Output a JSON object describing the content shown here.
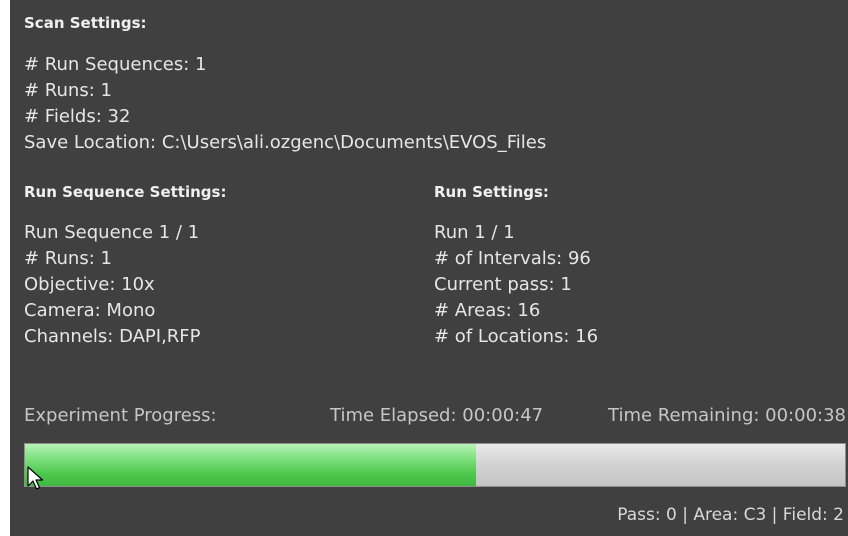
{
  "scan_settings": {
    "heading": "Scan Settings:",
    "lines": [
      "# Run Sequences: 1",
      "# Runs: 1",
      "# Fields: 32",
      "Save Location: C:\\Users\\ali.ozgenc\\Documents\\EVOS_Files"
    ]
  },
  "run_sequence_settings": {
    "heading": "Run Sequence Settings:",
    "lines": [
      "Run Sequence 1 / 1",
      "# Runs: 1",
      "Objective: 10x",
      "Camera: Mono",
      "Channels: DAPI,RFP"
    ]
  },
  "run_settings": {
    "heading": "Run Settings:",
    "lines": [
      "Run 1 / 1",
      "# of Intervals: 96",
      "Current pass: 1",
      "# Areas: 16",
      "# of Locations: 16"
    ]
  },
  "progress": {
    "label": "Experiment Progress:",
    "time_elapsed": "Time Elapsed: 00:00:47",
    "time_remaining": "Time Remaining: 00:00:38",
    "fraction": 0.55,
    "fill_color": "#4fc84f",
    "status": "Pass: 0 | Area: C3 | Field: 2"
  },
  "colors": {
    "panel_background": "#404040",
    "text": "#e6e6e6"
  },
  "icons": {
    "cursor": "mouse-pointer-icon"
  }
}
